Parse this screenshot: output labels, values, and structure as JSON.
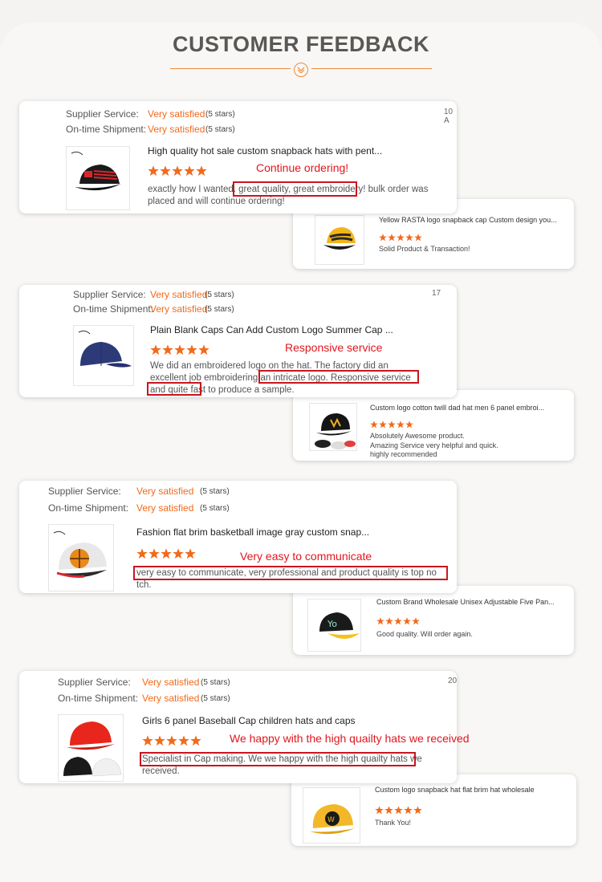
{
  "header": {
    "title": "CUSTOMER FEEDBACK"
  },
  "labels": {
    "supplier": "Supplier Service:",
    "ontime": "On-time Shipment:",
    "satisfied": "Very satisfied",
    "five_stars": "(5 stars)"
  },
  "colors": {
    "accent": "#f26a1b",
    "annotation": "#e0161e",
    "highlight_border": "#c8161e"
  },
  "reviews": [
    {
      "date": "10 A",
      "product_title": "High quality hot sale custom snapback hats with pent...",
      "rating": 5,
      "annotation": "Continue ordering!",
      "comment_before": "exactly how I wanted. ",
      "comment_highlight": "great quality, great embroidery!",
      "comment_after": " bulk order was placed and will continue ordering!",
      "sub": {
        "title": "Yellow RASTA logo snapback cap Custom design you...",
        "rating": 5,
        "text": "Solid Product & Transaction!"
      }
    },
    {
      "date": "17",
      "product_title": "Plain Blank Caps Can Add Custom Logo Summer Cap ...",
      "rating": 5,
      "annotation": "Responsive service",
      "comment_before": "We did an embroidered logo on the hat. The factory did an excellent job embroidering an intricate logo. ",
      "comment_highlight": "Responsive service and quite fast to produce a sample.",
      "comment_after": "",
      "sub": {
        "title": "Custom logo cotton twill dad hat men 6 panel embroi...",
        "rating": 5,
        "text": "Absolutely Awesome product.\nAmazing Service very helpful and quick.\nhighly recommended"
      }
    },
    {
      "date": "",
      "product_title": "Fashion flat brim basketball image gray custom snap...",
      "rating": 5,
      "annotation": "Very easy to communicate",
      "comment_before": "",
      "comment_highlight": "very easy to communicate, very professional and product quality is top no",
      "comment_after": "tch.",
      "sub": {
        "title": "Custom Brand Wholesale Unisex Adjustable Five Pan...",
        "rating": 5,
        "text": "Good quality. Will order again."
      }
    },
    {
      "date": "20",
      "product_title": "Girls 6 panel Baseball Cap children hats and caps",
      "rating": 5,
      "annotation": "We happy with the high quailty hats we received",
      "comment_before": "",
      "comment_highlight": "Specialist in Cap making. We we happy with the high quailty hats we",
      "comment_after": "received.",
      "sub": {
        "title": "Custom logo snapback hat flat brim hat wholesale",
        "rating": 5,
        "text": "Thank You!"
      }
    }
  ]
}
